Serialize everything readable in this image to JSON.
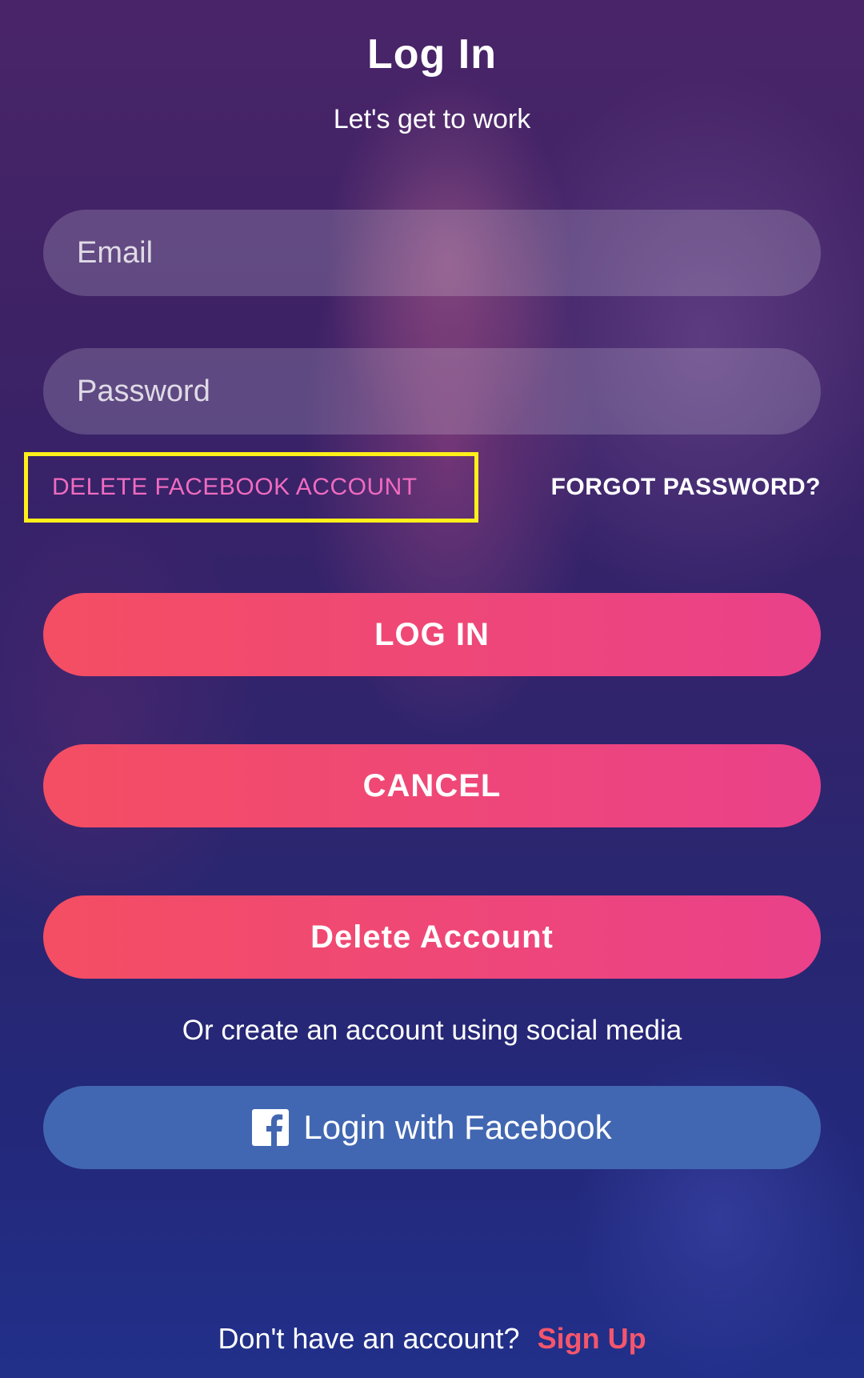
{
  "header": {
    "title": "Log In",
    "subtitle": "Let's get to work"
  },
  "form": {
    "email_placeholder": "Email",
    "password_placeholder": "Password"
  },
  "links": {
    "delete_facebook": "DELETE FACEBOOK ACCOUNT",
    "forgot_password": "FORGOT PASSWORD?"
  },
  "buttons": {
    "login": "LOG IN",
    "cancel": "CANCEL",
    "delete_account": "Delete Account"
  },
  "social": {
    "prompt": "Or create an account using social media",
    "facebook_label": "Login with Facebook",
    "facebook_icon": "facebook-icon"
  },
  "footer": {
    "question": "Don't have an account?",
    "signup": "Sign Up"
  },
  "colors": {
    "accent_gradient_start": "#f44e63",
    "accent_gradient_end": "#ea418a",
    "facebook_blue": "#4267b2",
    "highlight_border": "#ffef1a",
    "delete_link": "#f06bbf",
    "signup_link": "#f4566c"
  }
}
